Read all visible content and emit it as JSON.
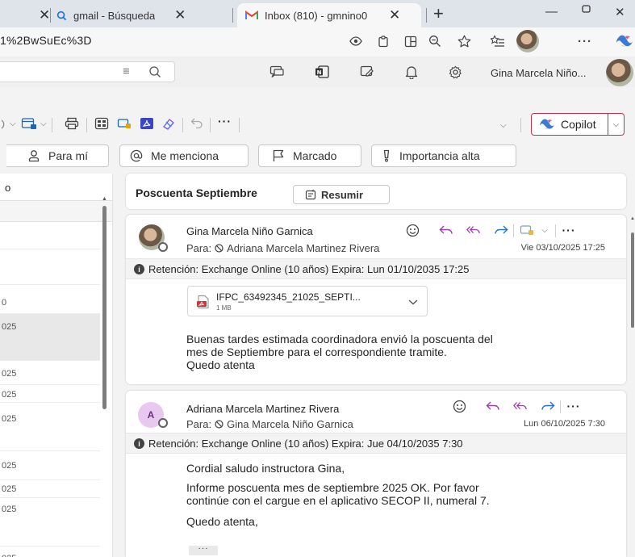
{
  "browser": {
    "tabs": [
      {
        "title": "gmail - Búsqueda"
      },
      {
        "title": "Inbox (810) - gmnino0"
      }
    ],
    "url": "1%2BwSuEc%3D"
  },
  "header": {
    "user_name": "Gina Marcela Niño..."
  },
  "ribbon": {
    "copilot_label": "Copilot"
  },
  "filters": [
    {
      "label": "Para mí"
    },
    {
      "label": "Me menciona"
    },
    {
      "label": "Marcado"
    },
    {
      "label": "Importancia alta"
    }
  ],
  "list": {
    "header": "o",
    "rows": [
      "0",
      "025",
      "025",
      "025",
      "025",
      "025",
      "025",
      "025",
      "025",
      "025"
    ]
  },
  "thread": {
    "subject": "Poscuenta Septiembre",
    "summarize_label": "Resumir",
    "messages": [
      {
        "sender": "Gina Marcela Niño Garnica",
        "to_prefix": "Para:",
        "to": "Adriana Marcela Martinez Rivera",
        "date": "Vie 03/10/2025 17:25",
        "retention": "Retención: Exchange Online (10 años) Expira: Lun 01/10/2035 17:25",
        "attachment": {
          "name": "IFPC_63492345_21025_SEPTI...",
          "size": "1 MB"
        },
        "body": [
          "Buenas tardes estimada coordinadora envió la poscuenta del",
          "mes de Septiembre para el correspondiente tramite.",
          "Quedo atenta"
        ]
      },
      {
        "avatar_initial": "A",
        "sender": "Adriana Marcela Martinez Rivera",
        "to_prefix": "Para:",
        "to": "Gina Marcela Niño Garnica",
        "date": "Lun 06/10/2025 7:30",
        "retention": "Retención: Exchange Online (10 años) Expira: Jue 04/10/2035 7:30",
        "body": [
          "Cordial saludo instructora Gina,",
          "Informe poscuenta mes de septiembre 2025 OK. Por favor",
          "continúe con el cargue en el aplicativo SECOP II, numeral 7.",
          "Quedo atenta,"
        ],
        "more_label": "···"
      }
    ]
  },
  "colors": {
    "accent": "#0f6cbd",
    "copilot_border": "#c4314b",
    "gmail_red": "#ea4335"
  }
}
